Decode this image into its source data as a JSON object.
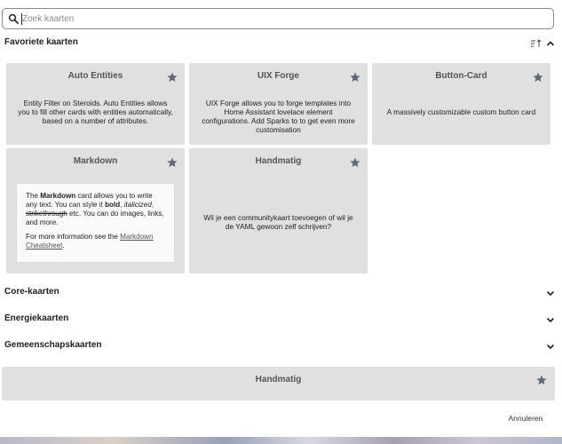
{
  "search": {
    "placeholder": "Zoek kaarten",
    "value": ""
  },
  "favorites": {
    "heading": "Favoriete kaarten",
    "cards": [
      {
        "title": "Auto Entities",
        "description": "Entity Filter on Steroids. Auto Entities allows you to fill other cards with entities automatically, based on a number of attributes."
      },
      {
        "title": "UIX Forge",
        "description": "UIX Forge allows you to forge templates into Home Assistant lovelace element configurations. Add Sparks to to get even more customisation"
      },
      {
        "title": "Button-Card",
        "description": "A massively customizable custom button card"
      }
    ],
    "markdown_card": {
      "title": "Markdown",
      "p1_a": "The ",
      "p1_bold_name": "Markdown",
      "p1_b": " card allows you to write any text. You can style it ",
      "p1_bold": "bold",
      "p1_c": ", ",
      "p1_italic": "italicized",
      "p1_d": ", ",
      "p1_strike": "strikethrough",
      "p1_e": " etc. You can do images, links, and more.",
      "p2_a": "For more information see the ",
      "p2_link": "Markdown Cheatsheet",
      "p2_b": "."
    },
    "manual_card": {
      "title": "Handmatig",
      "description": "Wil je een communitykaart toevoegen of wil je de YAML gewoon zelf schrijven?"
    }
  },
  "sections": [
    {
      "label": "Core-kaarten"
    },
    {
      "label": "Energiekaarten"
    },
    {
      "label": "Gemeenschapskaarten"
    }
  ],
  "bottom_card": {
    "title": "Handmatig"
  },
  "footer": {
    "cancel_label": "Annuleren"
  },
  "colors": {
    "card_bg": "#e0e0e0",
    "star": "#5f6a75",
    "text": "#212121"
  }
}
